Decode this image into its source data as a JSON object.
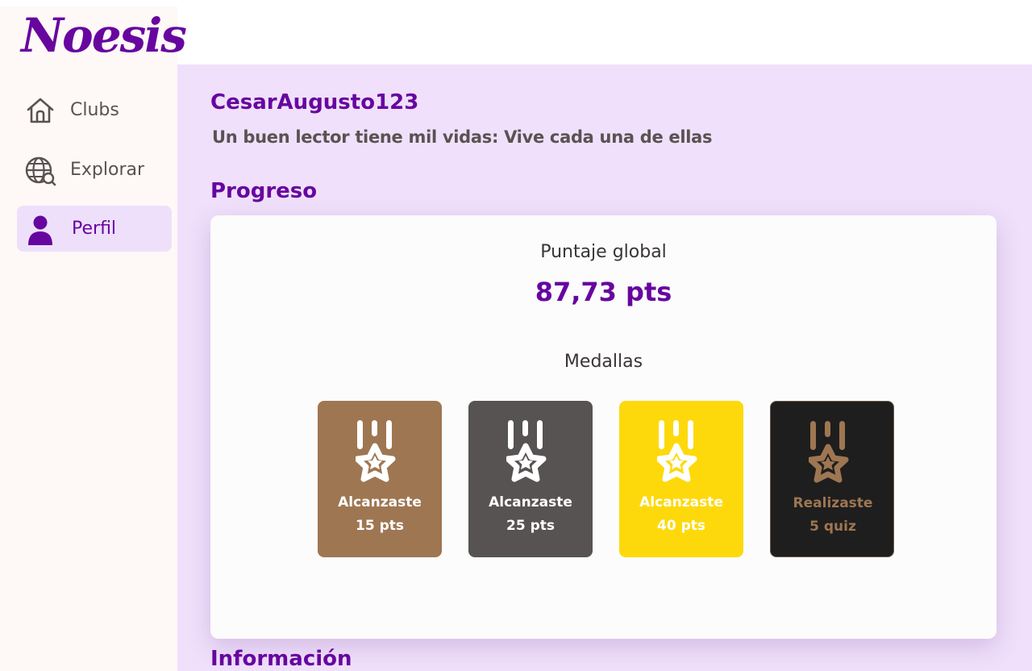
{
  "app": {
    "logo": "Noesis"
  },
  "sidebar": {
    "items": [
      {
        "label": "Clubs",
        "icon": "home-icon",
        "active": false
      },
      {
        "label": "Explorar",
        "icon": "globe-search-icon",
        "active": false
      },
      {
        "label": "Perfil",
        "icon": "user-icon",
        "active": true
      }
    ]
  },
  "profile": {
    "username": "CesarAugusto123",
    "bio": "Un buen lector tiene mil vidas: Vive cada una de ellas"
  },
  "progress": {
    "title": "Progreso",
    "score_label": "Puntaje global",
    "score_value": "87,73 pts",
    "medals_label": "Medallas",
    "medals": [
      {
        "line1": "Alcanzaste",
        "line2": "15 pts",
        "bg": "#9e7652",
        "fg": "#ffffff",
        "icon": "medal-star-icon"
      },
      {
        "line1": "Alcanzaste",
        "line2": "25 pts",
        "bg": "#575353",
        "fg": "#ffffff",
        "icon": "medal-star-icon"
      },
      {
        "line1": "Alcanzaste",
        "line2": "40 pts",
        "bg": "#fdd90b",
        "fg": "#ffffff",
        "icon": "medal-star-icon"
      },
      {
        "line1": "Realizaste",
        "line2": "5 quiz",
        "bg": "#1e1e1e",
        "fg": "#9e7652",
        "icon": "medal-star-icon"
      }
    ]
  },
  "info": {
    "title": "Información"
  },
  "colors": {
    "brand": "#67069f",
    "sidebar_bg": "#fef8f7",
    "main_bg": "#f0e0fb",
    "active_nav_bg": "#eee0fb",
    "card_bg": "#fcfcfc"
  }
}
